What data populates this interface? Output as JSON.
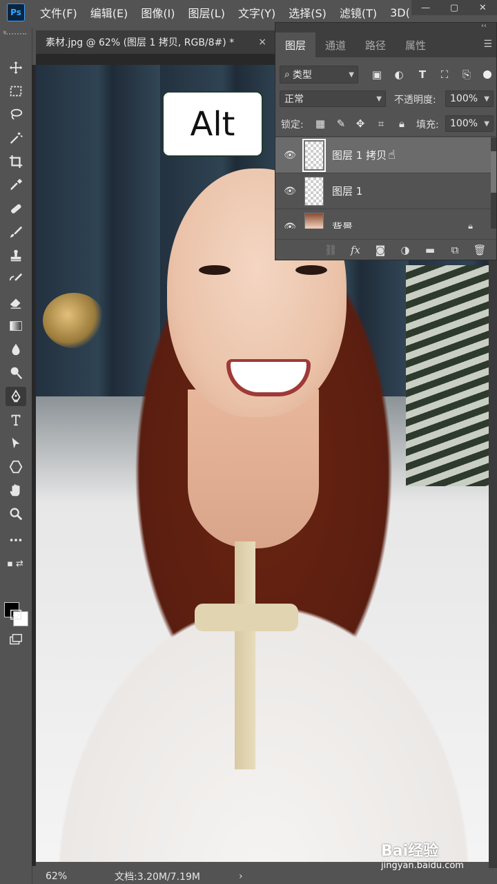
{
  "app": {
    "logo": "Ps",
    "menu": [
      "文件(F)",
      "编辑(E)",
      "图像(I)",
      "图层(L)",
      "文字(Y)",
      "选择(S)",
      "滤镜(T)",
      "3D("
    ],
    "window_controls": [
      "—",
      "▢",
      "✕"
    ]
  },
  "document": {
    "tab_title": "素材.jpg @ 62% (图层 1 拷贝, RGB/8#) *",
    "tab_close": "×"
  },
  "toolbar": {
    "tools": [
      "move-tool",
      "marquee-tool",
      "lasso-tool",
      "magic-wand-tool",
      "crop-tool",
      "eyedropper-tool",
      "healing-brush-tool",
      "brush-tool",
      "clone-stamp-tool",
      "history-brush-tool",
      "eraser-tool",
      "gradient-tool",
      "blur-tool",
      "dodge-tool",
      "pen-tool",
      "type-tool",
      "path-selection-tool",
      "shape-tool",
      "hand-tool",
      "zoom-tool",
      "more-tools"
    ],
    "active_tool": "pen-tool",
    "foreground_color": "#000000",
    "background_color": "#ffffff"
  },
  "overlay": {
    "key_label": "Alt"
  },
  "layers_panel": {
    "tabs": [
      "图层",
      "通道",
      "路径",
      "属性"
    ],
    "active_tab": "图层",
    "filter": {
      "label": "类型"
    },
    "blend_mode": "正常",
    "opacity_label": "不透明度:",
    "opacity_value": "100%",
    "lock_label": "锁定:",
    "fill_label": "填充:",
    "fill_value": "100%",
    "layers": [
      {
        "name": "图层 1 拷贝",
        "visible": true,
        "selected": true,
        "locked": false
      },
      {
        "name": "图层 1",
        "visible": true,
        "selected": false,
        "locked": false
      },
      {
        "name": "背景",
        "visible": true,
        "selected": false,
        "locked": true
      }
    ],
    "footer_fx": "fx"
  },
  "status": {
    "zoom": "62%",
    "doc_size": "文档:3.20M/7.19M",
    "arrow": "›"
  },
  "watermark": {
    "brand": "Bai经验",
    "url": "jingyan.baidu.com"
  }
}
